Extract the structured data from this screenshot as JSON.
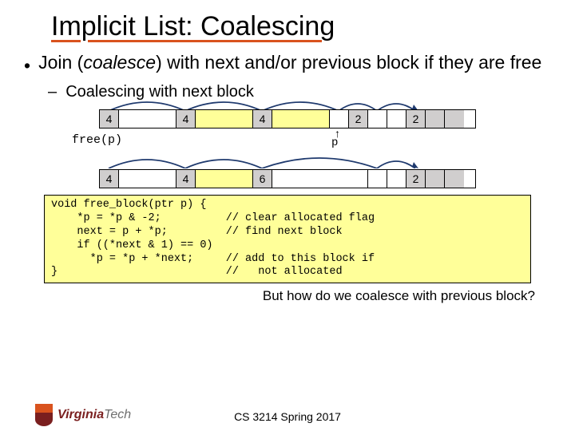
{
  "title": "Implicit List: Coalescing",
  "bullet_lead": "Join (",
  "bullet_em": "coalesce",
  "bullet_tail": ") with next and/or previous block if they are free",
  "sub_bullet": "–  Coalescing with next block",
  "row1": {
    "h0": "4",
    "h1": "4",
    "h2": "4",
    "h3": "2",
    "h4": "2"
  },
  "free_call": "free(p)",
  "p_label": "p",
  "row2": {
    "h0": "4",
    "h1": "4",
    "h2": "6",
    "h3": "2"
  },
  "code": "void free_block(ptr p) {\n    *p = *p & -2;          // clear allocated flag\n    next = p + *p;         // find next block\n    if ((*next & 1) == 0)\n      *p = *p + *next;     // add to this block if\n}                          //   not allocated",
  "closing": "But how do we coalesce with previous block?",
  "course": "CS 3214 Spring 2017",
  "logo_v": "Virginia",
  "logo_t": "Tech"
}
